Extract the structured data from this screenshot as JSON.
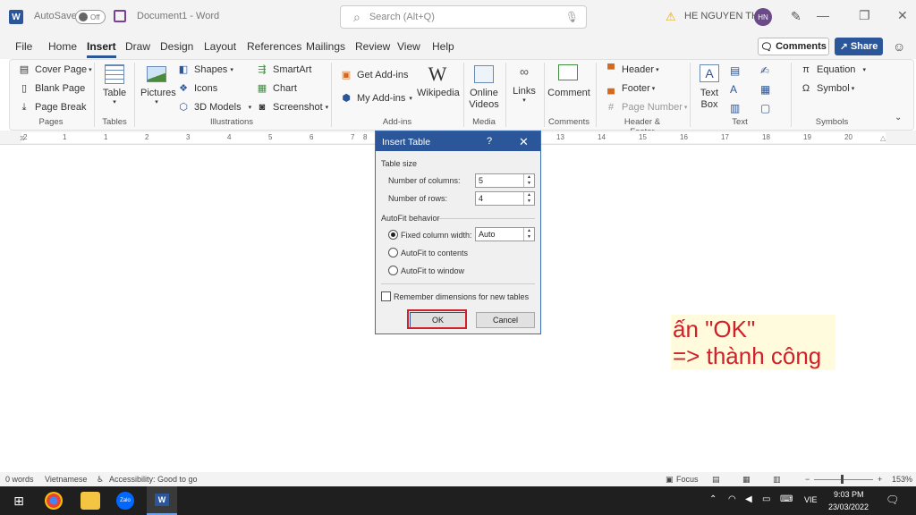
{
  "titlebar": {
    "app_icon": "W",
    "autosave_label": "AutoSave",
    "autosave_state": "Off",
    "document_title": "Document1  -  Word",
    "search_placeholder": "Search (Alt+Q)",
    "user_name": "HE NGUYEN THE",
    "user_initials": "HN"
  },
  "menu": {
    "items": [
      "File",
      "Home",
      "Insert",
      "Draw",
      "Design",
      "Layout",
      "References",
      "Mailings",
      "Review",
      "View",
      "Help"
    ],
    "active": "Insert",
    "comments_label": "Comments",
    "share_label": "Share"
  },
  "ribbon": {
    "pages": {
      "cover_page": "Cover Page",
      "blank_page": "Blank Page",
      "page_break": "Page Break",
      "group": "Pages"
    },
    "tables": {
      "table": "Table",
      "group": "Tables"
    },
    "illustrations": {
      "pictures": "Pictures",
      "shapes": "Shapes",
      "icons": "Icons",
      "models_3d": "3D Models",
      "smartart": "SmartArt",
      "chart": "Chart",
      "screenshot": "Screenshot",
      "group": "Illustrations"
    },
    "addins": {
      "get_addins": "Get Add-ins",
      "my_addins": "My Add-ins",
      "wikipedia": "Wikipedia",
      "group": "Add-ins"
    },
    "media": {
      "online_videos_1": "Online",
      "online_videos_2": "Videos",
      "group": "Media"
    },
    "links": {
      "links": "Links"
    },
    "comments": {
      "comment": "Comment",
      "group": "Comments"
    },
    "header_footer": {
      "header": "Header",
      "footer": "Footer",
      "page_number": "Page Number",
      "group": "Header & Footer"
    },
    "text": {
      "text_box_1": "Text",
      "text_box_2": "Box",
      "group": "Text"
    },
    "symbols": {
      "equation": "Equation",
      "symbol": "Symbol",
      "group": "Symbols"
    }
  },
  "ruler": {
    "ticks": [
      "2",
      "1",
      "1",
      "2",
      "3",
      "4",
      "5",
      "6",
      "7",
      "8",
      "13",
      "14",
      "15",
      "16",
      "17",
      "18",
      "19",
      "20"
    ]
  },
  "dialog": {
    "title": "Insert Table",
    "help": "?",
    "table_size_label": "Table size",
    "columns_label": "Number of columns:",
    "columns_value": "5",
    "rows_label": "Number of rows:",
    "rows_value": "4",
    "autofit_label": "AutoFit behavior",
    "fixed_width_label": "Fixed column width:",
    "fixed_width_value": "Auto",
    "autofit_contents_label": "AutoFit to contents",
    "autofit_window_label": "AutoFit to window",
    "remember_label": "Remember dimensions for new tables",
    "ok_label": "OK",
    "cancel_label": "Cancel"
  },
  "annotation": {
    "line1": "ấn \"OK\"",
    "line2": "=> thành công"
  },
  "statusbar": {
    "words": "0 words",
    "language": "Vietnamese",
    "accessibility": "Accessibility: Good to go",
    "focus": "Focus",
    "zoom": "153%"
  },
  "taskbar": {
    "language": "VIE",
    "time": "9:03 PM",
    "date": "23/03/2022",
    "zalo_label": "Zalo"
  },
  "colors": {
    "accent": "#2b579a",
    "highlight_red": "#d0202a",
    "annotation_bg": "#fffbdc"
  }
}
